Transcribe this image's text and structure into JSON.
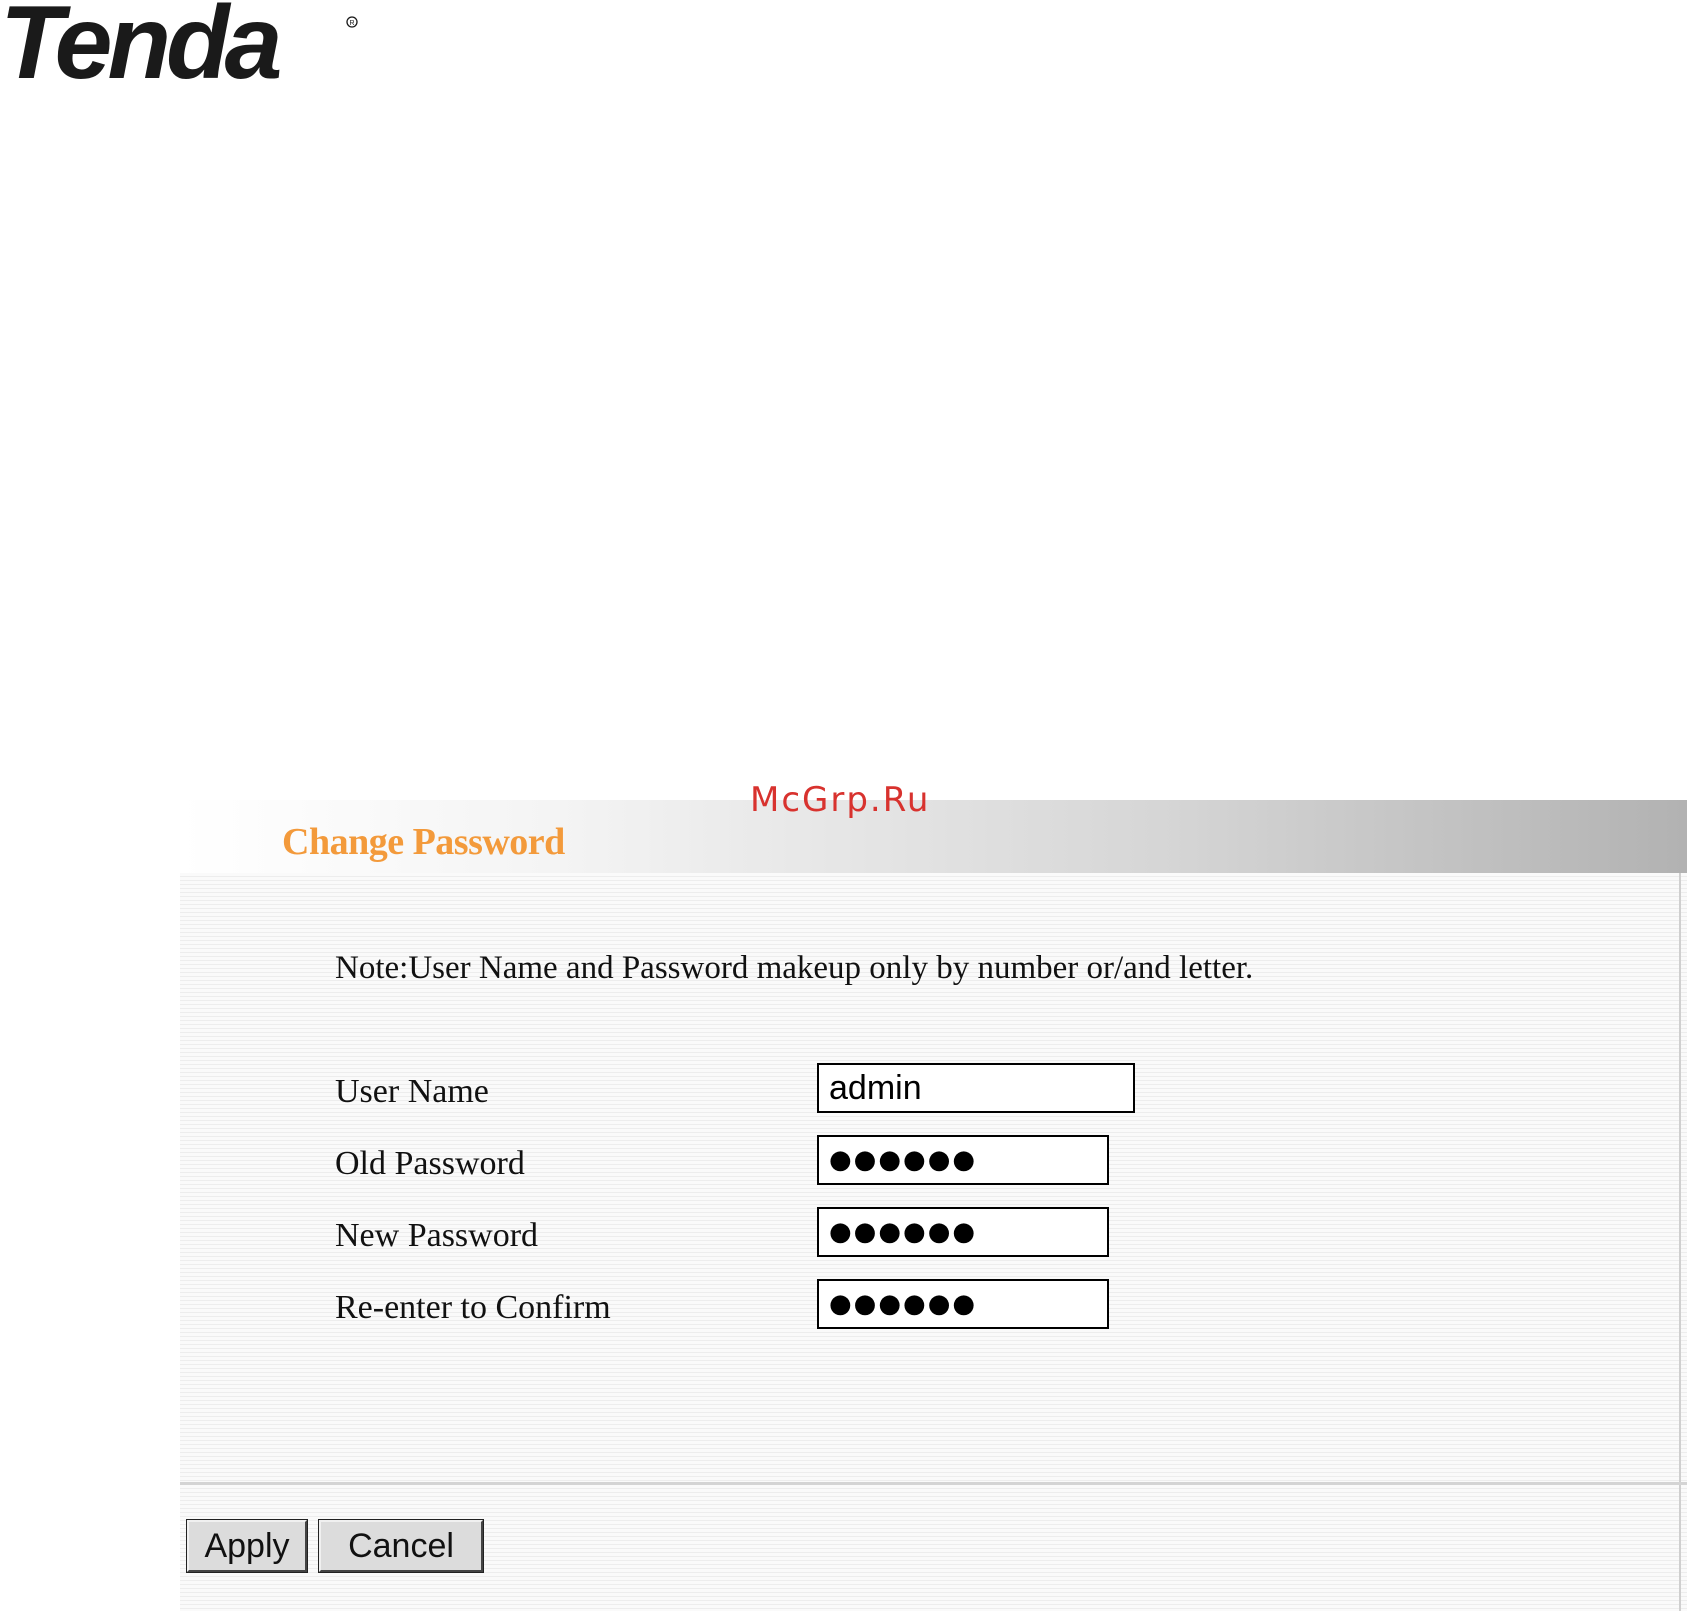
{
  "brand": {
    "logo_text": "Tenda"
  },
  "watermark": {
    "text": "McGrp.Ru"
  },
  "panel": {
    "title": "Change Password",
    "note": "Note:User Name and Password makeup only by number or/and letter.",
    "fields": [
      {
        "label": "User Name",
        "value": "admin"
      },
      {
        "label": "Old Password",
        "value": "●●●●●●"
      },
      {
        "label": "New Password",
        "value": "●●●●●●"
      },
      {
        "label": "Re-enter to Confirm",
        "value": "●●●●●●"
      }
    ],
    "apply_label": "Apply",
    "cancel_label": "Cancel"
  },
  "colors": {
    "title_orange": "#f39a3b",
    "watermark_red": "#d8322e"
  }
}
